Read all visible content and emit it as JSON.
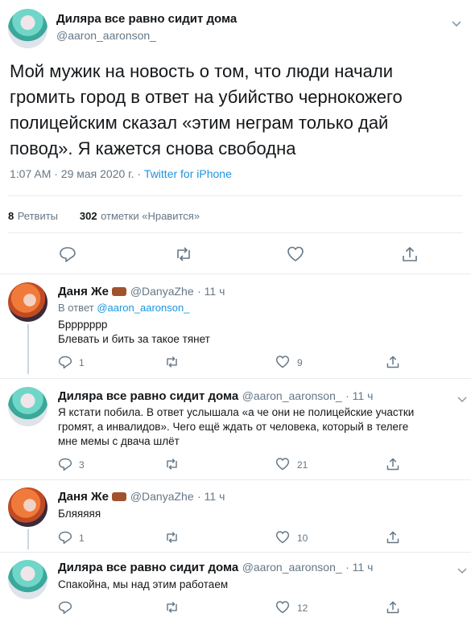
{
  "tweet": {
    "author_name": "Диляра все равно сидит дома",
    "author_handle": "@aaron_aaronson_",
    "text_lines": [
      "Мой мужик на новость о том, что люди начали",
      "громить город в ответ на убийство чернокожего",
      "полицейским сказал «этим неграм только дай",
      "повод». Я кажется снова свободна"
    ],
    "time": "1:07 AM · 29 мая 2020 г. · ",
    "source": "Twitter for iPhone",
    "retweets_count": "8",
    "retweets_label": "Ретвиты",
    "likes_count": "302",
    "likes_label": "отметки «Нравится»"
  },
  "replies": [
    {
      "name": "Даня Же",
      "handle": "@DanyaZhe",
      "time": "· 11 ч",
      "reply_to_prefix": "В ответ ",
      "reply_to_handle": "@aaron_aaronson_",
      "lines": [
        "Бррррррр",
        "Блевать и бить за такое тянет"
      ],
      "reply_count": "1",
      "retweet_count": "",
      "like_count": "9"
    },
    {
      "name": "Диляра все равно сидит дома",
      "handle": "@aaron_aaronson_",
      "time": "· 11 ч",
      "lines": [
        "Я кстати побила. В ответ услышала «а че они не полицейские участки",
        "громят, а инвалидов». Чего ещё ждать от человека, который в телеге",
        "мне мемы с двача шлёт"
      ],
      "reply_count": "3",
      "retweet_count": "",
      "like_count": "21"
    },
    {
      "name": "Даня Же",
      "handle": "@DanyaZhe",
      "time": "· 11 ч",
      "lines": [
        "Бляяяяя"
      ],
      "reply_count": "1",
      "retweet_count": "",
      "like_count": "10"
    },
    {
      "name": "Диляра все равно сидит дома",
      "handle": "@aaron_aaronson_",
      "time": "· 11 ч",
      "lines": [
        "Спакойна, мы над этим работаем"
      ],
      "reply_count": "",
      "retweet_count": "",
      "like_count": "12"
    }
  ],
  "icons": {
    "reply": "reply-icon",
    "retweet": "retweet-icon",
    "like": "heart-icon",
    "share": "share-icon"
  },
  "colors": {
    "link": "#1b95e0",
    "secondary_text": "#657786",
    "divider": "#e6ecf0"
  }
}
